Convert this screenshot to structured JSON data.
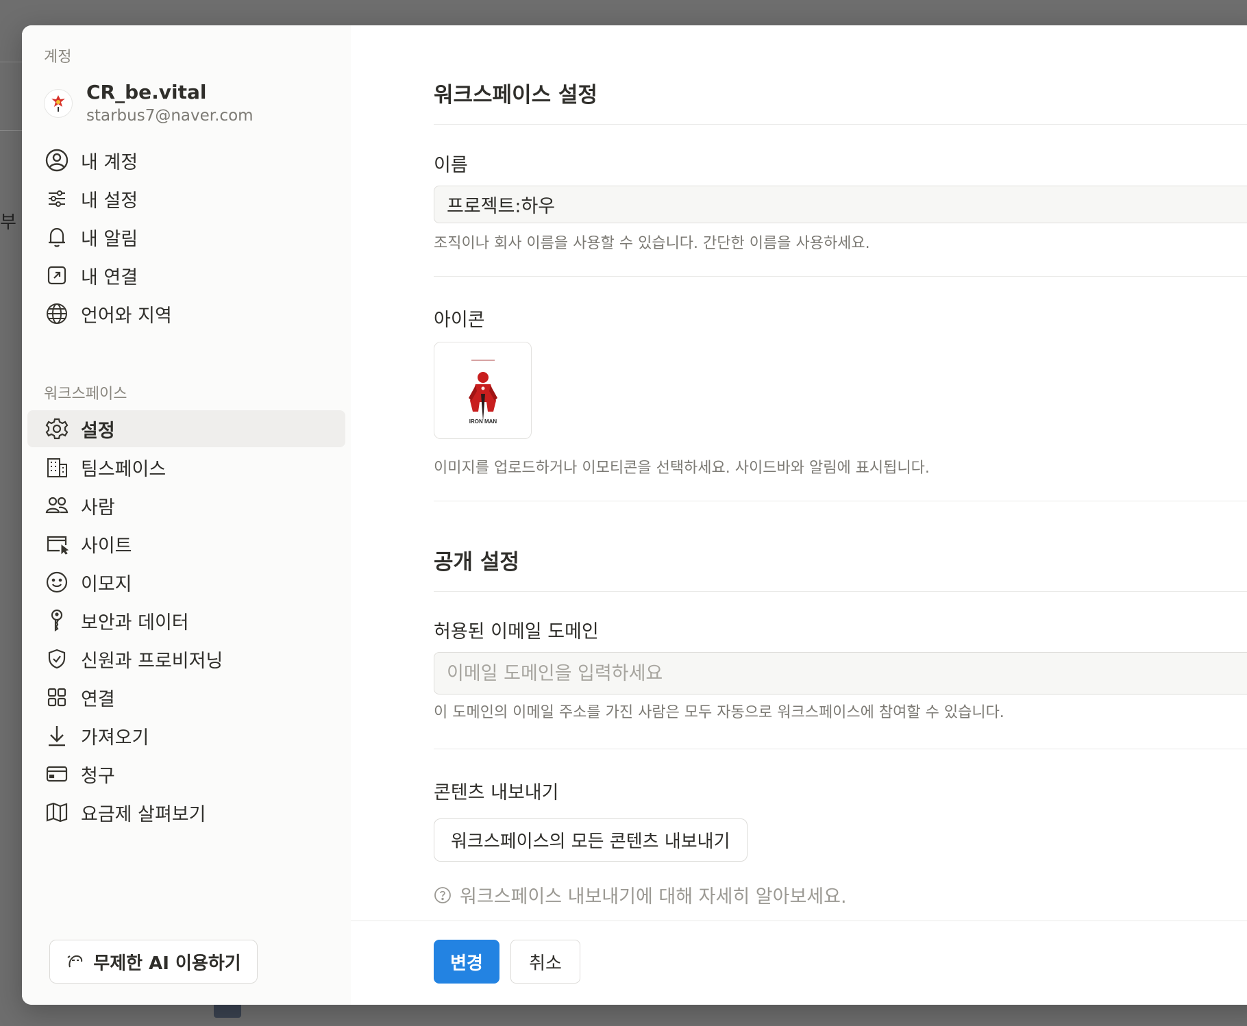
{
  "sidebar": {
    "account_section": "계정",
    "profile": {
      "name": "CR_be.vital",
      "email": "starbus7@naver.com"
    },
    "account_items": [
      {
        "label": "내 계정",
        "icon": "user-circle-icon"
      },
      {
        "label": "내 설정",
        "icon": "sliders-icon"
      },
      {
        "label": "내 알림",
        "icon": "bell-icon"
      },
      {
        "label": "내 연결",
        "icon": "external-link-icon"
      },
      {
        "label": "언어와 지역",
        "icon": "globe-icon"
      }
    ],
    "workspace_section": "워크스페이스",
    "workspace_items": [
      {
        "label": "설정",
        "icon": "gear-icon",
        "active": true
      },
      {
        "label": "팀스페이스",
        "icon": "building-icon"
      },
      {
        "label": "사람",
        "icon": "people-icon"
      },
      {
        "label": "사이트",
        "icon": "browser-cursor-icon"
      },
      {
        "label": "이모지",
        "icon": "smiley-icon"
      },
      {
        "label": "보안과 데이터",
        "icon": "key-icon"
      },
      {
        "label": "신원과 프로비저닝",
        "icon": "shield-check-icon"
      },
      {
        "label": "연결",
        "icon": "grid-icon"
      },
      {
        "label": "가져오기",
        "icon": "download-icon"
      },
      {
        "label": "청구",
        "icon": "credit-card-icon"
      },
      {
        "label": "요금제 살펴보기",
        "icon": "map-icon"
      }
    ],
    "ai_button": "무제한 AI 이용하기"
  },
  "main": {
    "workspace_heading": "워크스페이스 설정",
    "name_label": "이름",
    "name_value": "프로젝트:하우",
    "name_help": "조직이나 회사 이름을 사용할 수 있습니다. 간단한 이름을 사용하세요.",
    "icon_label": "아이콘",
    "icon_image_text": "IRON MAN",
    "icon_help": "이미지를 업로드하거나 이모티콘을 선택하세요. 사이드바와 알림에 표시됩니다.",
    "public_heading": "공개 설정",
    "domain_label": "허용된 이메일 도메인",
    "domain_placeholder": "이메일 도메인을 입력하세요",
    "domain_help": "이 도메인의 이메일 주소를 가진 사람은 모두 자동으로 워크스페이스에 참여할 수 있습니다.",
    "export_label": "콘텐츠 내보내기",
    "export_button": "워크스페이스의 모든 콘텐츠 내보내기",
    "export_learn": "워크스페이스 내보내기에 대해 자세히 알아보세요."
  },
  "footer": {
    "save": "변경",
    "cancel": "취소"
  },
  "colors": {
    "primary": "#2383e2",
    "sidebar_bg": "#fbfbfa",
    "active_bg": "#efeeec",
    "overlay": "#6e6e6e"
  },
  "background": {
    "partial_text": "부 ⸢"
  }
}
